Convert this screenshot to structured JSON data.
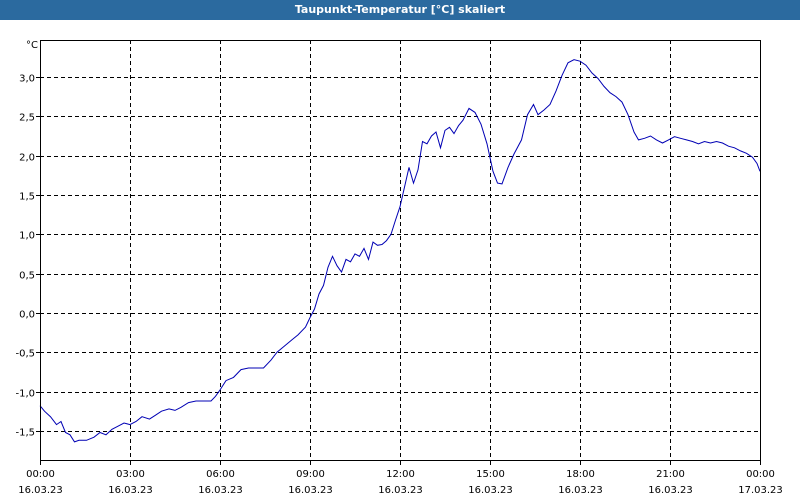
{
  "window": {
    "title": "Taupunkt-Temperatur [°C] skaliert"
  },
  "colors": {
    "titlebar": "#2b6a9f",
    "line": "#0000b4",
    "grid": "#000000"
  },
  "chart_data": {
    "type": "line",
    "title": "Taupunkt-Temperatur [°C] skaliert",
    "ylabel": "°C",
    "ylim": [
      -1.87,
      3.47
    ],
    "xlim_hours": [
      0,
      24
    ],
    "grid": true,
    "y_ticks": [
      "3,0",
      "2,5",
      "2,0",
      "1,5",
      "1,0",
      "0,5",
      "0,0",
      "-0,5",
      "-1,0",
      "-1,5"
    ],
    "y_tick_values": [
      3.0,
      2.5,
      2.0,
      1.5,
      1.0,
      0.5,
      0.0,
      -0.5,
      -1.0,
      -1.5
    ],
    "x_ticks": [
      {
        "time": "00:00",
        "date": "16.03.23"
      },
      {
        "time": "03:00",
        "date": "16.03.23"
      },
      {
        "time": "06:00",
        "date": "16.03.23"
      },
      {
        "time": "09:00",
        "date": "16.03.23"
      },
      {
        "time": "12:00",
        "date": "16.03.23"
      },
      {
        "time": "15:00",
        "date": "16.03.23"
      },
      {
        "time": "18:00",
        "date": "16.03.23"
      },
      {
        "time": "21:00",
        "date": "16.03.23"
      },
      {
        "time": "00:00",
        "date": "17.03.23"
      }
    ],
    "series": [
      {
        "points": [
          [
            0.0,
            -1.18
          ],
          [
            0.15,
            -1.25
          ],
          [
            0.35,
            -1.32
          ],
          [
            0.55,
            -1.42
          ],
          [
            0.7,
            -1.38
          ],
          [
            0.85,
            -1.52
          ],
          [
            1.0,
            -1.55
          ],
          [
            1.15,
            -1.64
          ],
          [
            1.3,
            -1.62
          ],
          [
            1.55,
            -1.62
          ],
          [
            1.8,
            -1.58
          ],
          [
            2.0,
            -1.52
          ],
          [
            2.2,
            -1.55
          ],
          [
            2.4,
            -1.48
          ],
          [
            2.6,
            -1.44
          ],
          [
            2.8,
            -1.4
          ],
          [
            3.0,
            -1.42
          ],
          [
            3.2,
            -1.38
          ],
          [
            3.4,
            -1.32
          ],
          [
            3.65,
            -1.35
          ],
          [
            3.85,
            -1.3
          ],
          [
            4.05,
            -1.25
          ],
          [
            4.3,
            -1.22
          ],
          [
            4.5,
            -1.24
          ],
          [
            4.7,
            -1.2
          ],
          [
            4.95,
            -1.14
          ],
          [
            5.2,
            -1.12
          ],
          [
            5.45,
            -1.12
          ],
          [
            5.7,
            -1.12
          ],
          [
            5.85,
            -1.06
          ],
          [
            6.0,
            -0.98
          ],
          [
            6.2,
            -0.86
          ],
          [
            6.45,
            -0.82
          ],
          [
            6.7,
            -0.72
          ],
          [
            6.95,
            -0.7
          ],
          [
            7.2,
            -0.7
          ],
          [
            7.45,
            -0.7
          ],
          [
            7.7,
            -0.6
          ],
          [
            7.9,
            -0.5
          ],
          [
            8.15,
            -0.42
          ],
          [
            8.4,
            -0.34
          ],
          [
            8.6,
            -0.28
          ],
          [
            8.85,
            -0.18
          ],
          [
            9.0,
            -0.06
          ],
          [
            9.15,
            0.05
          ],
          [
            9.3,
            0.24
          ],
          [
            9.45,
            0.35
          ],
          [
            9.6,
            0.58
          ],
          [
            9.75,
            0.72
          ],
          [
            9.9,
            0.6
          ],
          [
            10.05,
            0.52
          ],
          [
            10.2,
            0.68
          ],
          [
            10.35,
            0.65
          ],
          [
            10.5,
            0.75
          ],
          [
            10.65,
            0.72
          ],
          [
            10.8,
            0.82
          ],
          [
            10.95,
            0.68
          ],
          [
            11.1,
            0.9
          ],
          [
            11.25,
            0.86
          ],
          [
            11.4,
            0.87
          ],
          [
            11.55,
            0.92
          ],
          [
            11.7,
            1.0
          ],
          [
            11.85,
            1.18
          ],
          [
            12.0,
            1.35
          ],
          [
            12.15,
            1.6
          ],
          [
            12.3,
            1.85
          ],
          [
            12.45,
            1.65
          ],
          [
            12.6,
            1.82
          ],
          [
            12.75,
            2.18
          ],
          [
            12.9,
            2.15
          ],
          [
            13.05,
            2.25
          ],
          [
            13.2,
            2.3
          ],
          [
            13.35,
            2.1
          ],
          [
            13.5,
            2.32
          ],
          [
            13.65,
            2.36
          ],
          [
            13.8,
            2.28
          ],
          [
            13.95,
            2.38
          ],
          [
            14.1,
            2.45
          ],
          [
            14.3,
            2.6
          ],
          [
            14.5,
            2.55
          ],
          [
            14.7,
            2.4
          ],
          [
            14.9,
            2.15
          ],
          [
            15.1,
            1.8
          ],
          [
            15.25,
            1.65
          ],
          [
            15.4,
            1.64
          ],
          [
            15.6,
            1.85
          ],
          [
            15.8,
            2.02
          ],
          [
            16.05,
            2.2
          ],
          [
            16.25,
            2.52
          ],
          [
            16.45,
            2.65
          ],
          [
            16.6,
            2.52
          ],
          [
            16.8,
            2.58
          ],
          [
            17.0,
            2.65
          ],
          [
            17.2,
            2.82
          ],
          [
            17.4,
            3.02
          ],
          [
            17.6,
            3.18
          ],
          [
            17.8,
            3.22
          ],
          [
            18.0,
            3.2
          ],
          [
            18.2,
            3.15
          ],
          [
            18.4,
            3.05
          ],
          [
            18.6,
            2.98
          ],
          [
            18.8,
            2.88
          ],
          [
            19.0,
            2.8
          ],
          [
            19.2,
            2.75
          ],
          [
            19.4,
            2.68
          ],
          [
            19.6,
            2.52
          ],
          [
            19.8,
            2.3
          ],
          [
            19.95,
            2.2
          ],
          [
            20.15,
            2.22
          ],
          [
            20.35,
            2.25
          ],
          [
            20.55,
            2.2
          ],
          [
            20.75,
            2.16
          ],
          [
            20.95,
            2.2
          ],
          [
            21.15,
            2.24
          ],
          [
            21.35,
            2.22
          ],
          [
            21.55,
            2.2
          ],
          [
            21.75,
            2.18
          ],
          [
            21.95,
            2.15
          ],
          [
            22.15,
            2.18
          ],
          [
            22.35,
            2.16
          ],
          [
            22.55,
            2.18
          ],
          [
            22.75,
            2.16
          ],
          [
            22.95,
            2.12
          ],
          [
            23.15,
            2.1
          ],
          [
            23.35,
            2.06
          ],
          [
            23.55,
            2.03
          ],
          [
            23.75,
            1.98
          ],
          [
            23.9,
            1.9
          ],
          [
            24.0,
            1.8
          ]
        ]
      }
    ]
  }
}
